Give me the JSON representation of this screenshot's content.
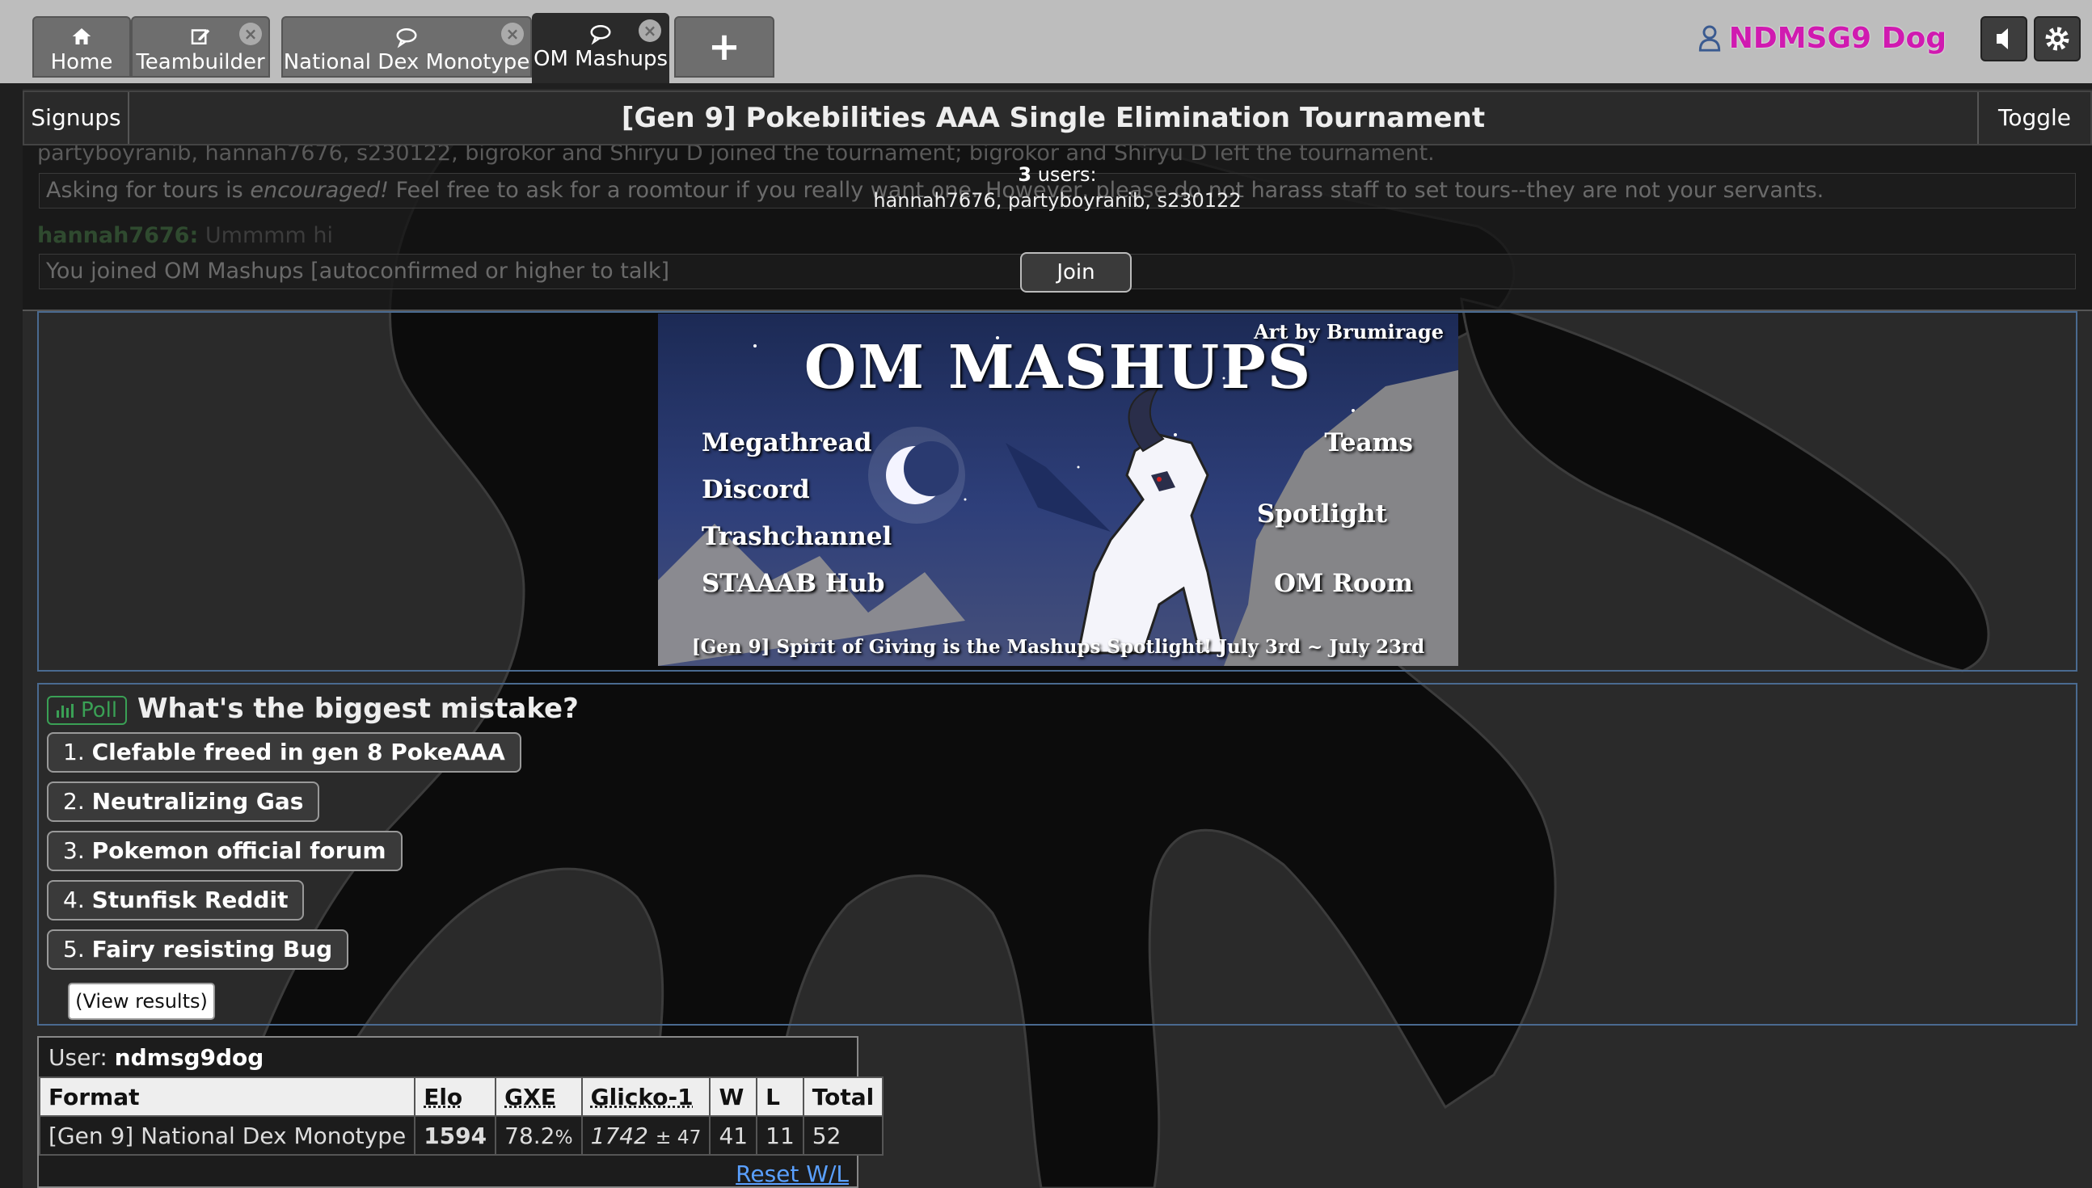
{
  "tabs": [
    {
      "label": "Home",
      "icon": "home-icon"
    },
    {
      "label": "Teambuilder",
      "icon": "edit-icon"
    },
    {
      "label": "National Dex Monotype",
      "icon": "chat-icon"
    },
    {
      "label": "OM Mashups",
      "icon": "chat-icon"
    },
    {
      "label": "+",
      "icon": "plus-icon"
    }
  ],
  "user": {
    "name": "NDMSG9 Dog",
    "name_color": "#d01ab0"
  },
  "tournament": {
    "signups_label": "Signups",
    "title": "[Gen 9] Pokebilities AAA Single Elimination Tournament",
    "toggle_label": "Toggle",
    "users_count": "3",
    "users_word": "users:",
    "users_list": "hannah7676, partyboyranib, s230122",
    "join_label": "Join"
  },
  "chat_lines": {
    "joined_msg": "partyboyranib, hannah7676, s230122, bigrokor and Shiryu D joined the tournament; bigrokor and Shiryu D left the tournament.",
    "notice_prefix": "Asking for tours is ",
    "notice_emph": "encouraged!",
    "notice_rest": " Feel free to ask for a roomtour if you really want one. However, please do not harass staff to set tours--they are not your servants.",
    "chat_user": "hannah7676:",
    "chat_msg": "Ummmm hi",
    "joined_room": "You joined OM Mashups [autoconfirmed or higher to talk]"
  },
  "banner": {
    "title": "OM MASHUPS",
    "art_credit": "Art by Brumirage",
    "left_links": [
      "Megathread",
      "Discord",
      "Trashchannel",
      "STAAAB Hub"
    ],
    "right_links": [
      "Teams",
      "Spotlight",
      "OM Room"
    ],
    "footer": "[Gen 9] Spirit of Giving is the Mashups Spotlight! July 3rd ~ July 23rd"
  },
  "poll": {
    "tag": "Poll",
    "question": "What's the biggest mistake?",
    "options": [
      {
        "num": "1.",
        "label": "Clefable freed in gen 8 PokeAAA"
      },
      {
        "num": "2.",
        "label": "Neutralizing Gas"
      },
      {
        "num": "3.",
        "label": "Pokemon official forum"
      },
      {
        "num": "4.",
        "label": "Stunfisk Reddit"
      },
      {
        "num": "5.",
        "label": "Fairy resisting Bug"
      }
    ],
    "view_results": "(View results)"
  },
  "ladder": {
    "user_label": "User:",
    "username": "ndmsg9dog",
    "headers": [
      "Format",
      "Elo",
      "GXE",
      "Glicko-1",
      "W",
      "L",
      "Total"
    ],
    "row": {
      "format": "[Gen 9] National Dex Monotype",
      "elo": "1594",
      "gxe": "78.2",
      "gxe_unit": "%",
      "glicko": "1742",
      "glicko_dev": "± 47",
      "w": "41",
      "l": "11",
      "total": "52"
    },
    "reset_label": "Reset W/L"
  }
}
